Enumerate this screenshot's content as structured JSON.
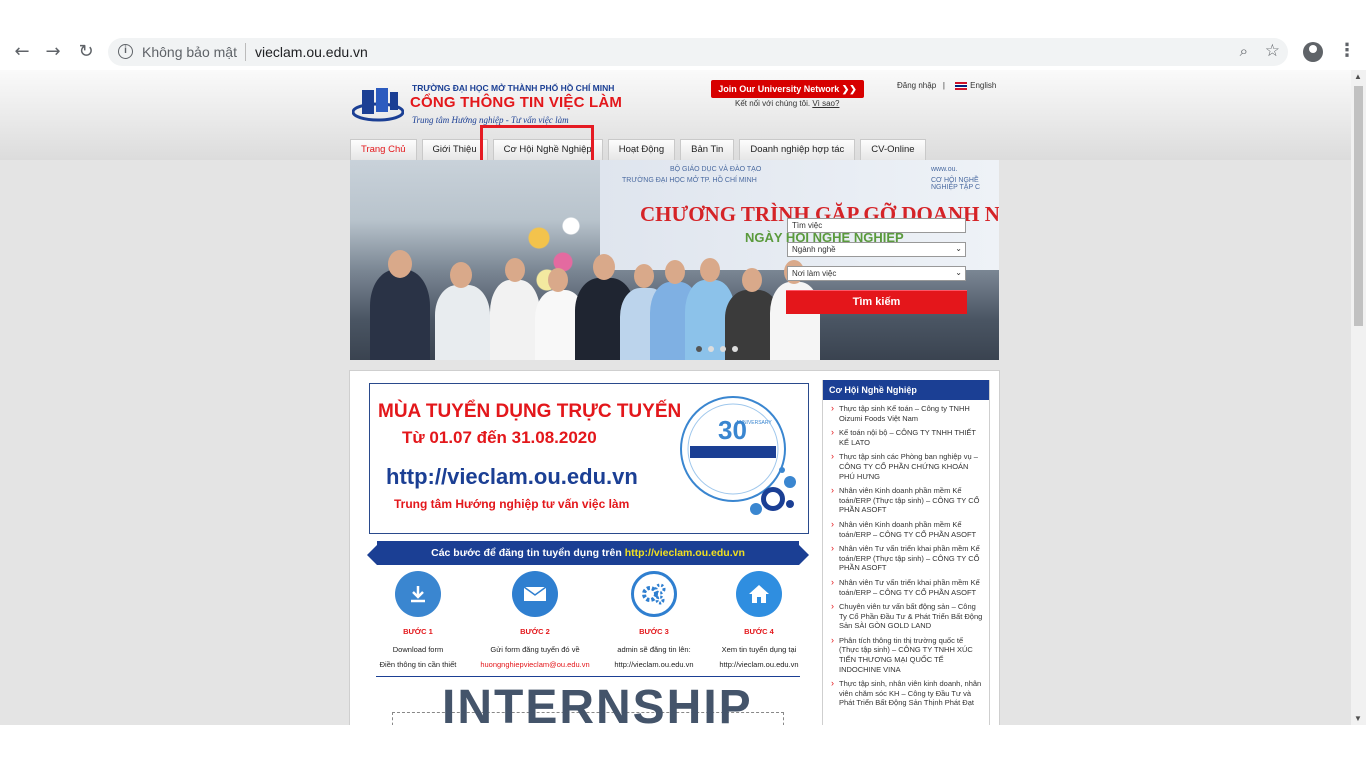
{
  "browser": {
    "security_label": "Không bảo mật",
    "url": "vieclam.ou.edu.vn"
  },
  "header": {
    "logo_line1": "TRƯỜNG ĐẠI HỌC MỞ THÀNH PHỐ HỒ CHÍ MINH",
    "logo_line2": "CỔNG THÔNG TIN VIỆC LÀM",
    "logo_line3": "Trung tâm Hướng nghiệp - Tư vấn việc làm",
    "join_button": "Join Our University Network ❯❯",
    "connect_text": "Kết nối với chúng tôi.",
    "why_link": "Vì sao?",
    "login": "Đăng nhập",
    "separator": "|",
    "language": "English"
  },
  "nav": {
    "tabs": [
      "Trang Chủ",
      "Giới Thiệu",
      "Cơ Hội Nghề Nghiệp",
      "Hoạt Động",
      "Bản Tin",
      "Doanh nghiệp hợp tác",
      "CV-Online"
    ]
  },
  "banner": {
    "title": "CHƯƠNG TRÌNH GẶP GỠ DOANH NGH",
    "subtitle": "NGÀY HỘI NGHỀ NGHIỆP",
    "org1": "BỘ GIÁO DỤC VÀ ĐÀO TẠO",
    "org2": "TRƯỜNG ĐẠI HỌC MỞ TP. HỒ CHÍ MINH",
    "web": "www.ou.",
    "opp": "CƠ HỘI NGHỀ NGHIỆP TẬP C"
  },
  "search": {
    "keyword_placeholder": "Tìm việc",
    "industry_select": "Ngành nghề",
    "location_select": "Nơi làm việc",
    "button": "Tìm kiếm"
  },
  "promo": {
    "line1": "MÙA TUYỂN DỤNG TRỰC TUYẾN",
    "line2": "Từ 01.07 đến 31.08.2020",
    "url": "http://vieclam.ou.edu.vn",
    "line4": "Trung tâm Hướng nghiệp tư vấn việc làm",
    "anniv_number": "30",
    "anniv_word": "ANNIVERSARY"
  },
  "steps": {
    "ribbon_text": "Các bước để đăng tin tuyển dụng trên",
    "ribbon_url": "http://vieclam.ou.edu.vn",
    "items": [
      {
        "label": "BƯỚC 1",
        "d1": "Download form",
        "d2": "Điền thông tin cần thiết"
      },
      {
        "label": "BƯỚC 2",
        "d1": "Gửi form đăng tuyển đó về",
        "d2": "huongnghiepvieclam@ou.edu.vn"
      },
      {
        "label": "BƯỚC 3",
        "d1": "admin sẽ đăng tin lên:",
        "d2": "http://vieclam.ou.edu.vn"
      },
      {
        "label": "BƯỚC 4",
        "d1": "Xem tin tuyển dụng tại",
        "d2": "http://vieclam.ou.edu.vn"
      }
    ],
    "icons": [
      "download-icon",
      "envelope-icon",
      "gears-icon",
      "home-icon"
    ]
  },
  "internship": "INTERNSHIP",
  "sidebar": {
    "title": "Cơ Hội Nghề Nghiệp",
    "jobs": [
      "Thực tập sinh Kế toán – Công ty TNHH Oizumi Foods Việt Nam",
      "Kế toán nội bộ – CÔNG TY TNHH THIẾT KẾ LATO",
      "Thực tập sinh các Phòng ban nghiệp vụ – CÔNG TY CỔ PHẦN CHỨNG KHOÁN PHÚ HƯNG",
      "Nhân viên Kinh doanh phần mềm Kế toán/ERP (Thực tập sinh) – CÔNG TY CỔ PHẦN ASOFT",
      "Nhân viên Kinh doanh phần mềm Kế toán/ERP – CÔNG TY CỔ PHẦN ASOFT",
      "Nhân viên Tư vấn triển khai phần mềm Kế toán/ERP (Thực tập sinh) – CÔNG TY CỔ PHẦN ASOFT",
      "Nhân viên Tư vấn triển khai phần mềm Kế toán/ERP – CÔNG TY CỔ PHẦN ASOFT",
      "Chuyên viên tư vấn bất động sản – Công Ty Cổ Phần Đầu Tư & Phát Triển Bất Động Sản SÀI GÒN GOLD LAND",
      "Phân tích thông tin thị trường quốc tế (Thực tập sinh) – CÔNG TY TNHH XÚC TIẾN THƯƠNG MẠI QUỐC TẾ INDOCHINE VINA",
      "Thực tập sinh, nhân viên kinh doanh, nhân viên chăm sóc KH – Công ty Đầu Tư và Phát Triển Bất Động Sản Thịnh Phát Đạt"
    ]
  },
  "colors": {
    "brand_red": "#e3171b",
    "brand_blue": "#1b3f94"
  }
}
